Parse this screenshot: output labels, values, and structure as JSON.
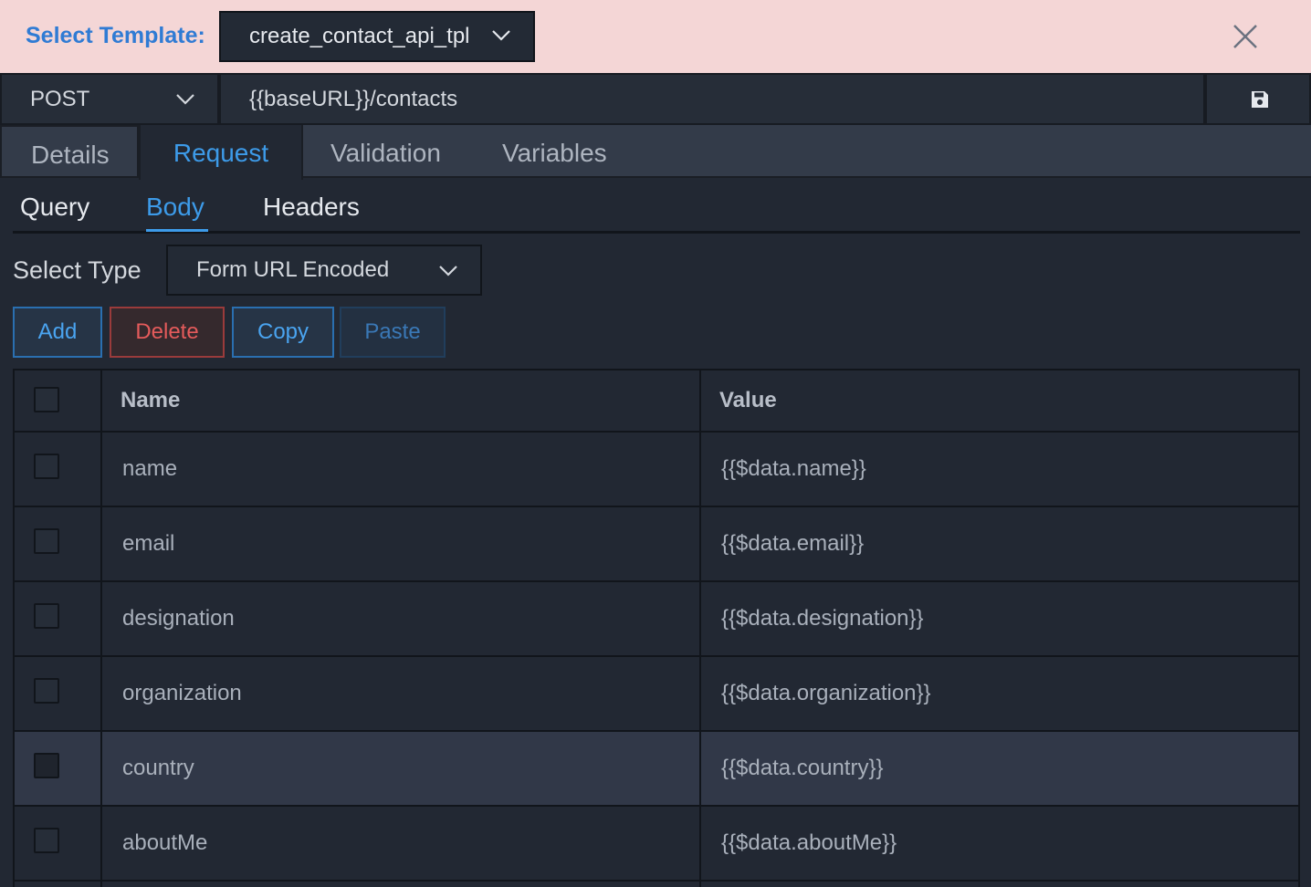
{
  "template": {
    "label": "Select Template:",
    "selected": "create_contact_api_tpl"
  },
  "request_line": {
    "method": "POST",
    "url": "{{baseURL}}/contacts"
  },
  "main_tabs": [
    {
      "label": "Details"
    },
    {
      "label": "Request"
    },
    {
      "label": "Validation"
    },
    {
      "label": "Variables"
    }
  ],
  "sub_tabs": [
    {
      "label": "Query"
    },
    {
      "label": "Body"
    },
    {
      "label": "Headers"
    }
  ],
  "body": {
    "type_label": "Select Type",
    "type_value": "Form URL Encoded"
  },
  "actions": {
    "add": "Add",
    "delete": "Delete",
    "copy": "Copy",
    "paste": "Paste"
  },
  "table": {
    "columns": {
      "name": "Name",
      "value": "Value"
    },
    "rows": [
      {
        "name": "name",
        "value": "{{$data.name}}"
      },
      {
        "name": "email",
        "value": "{{$data.email}}"
      },
      {
        "name": "designation",
        "value": "{{$data.designation}}"
      },
      {
        "name": "organization",
        "value": "{{$data.organization}}"
      },
      {
        "name": "country",
        "value": "{{$data.country}}"
      },
      {
        "name": "aboutMe",
        "value": "{{$data.aboutMe}}"
      }
    ]
  },
  "icons": {
    "close": "close-icon",
    "save": "save-icon",
    "dropdown": "chevron-down-icon"
  },
  "colors": {
    "accent": "#3d9be9",
    "danger": "#e45b5b",
    "template_bar": "#f4d6d6",
    "background": "#222833"
  }
}
